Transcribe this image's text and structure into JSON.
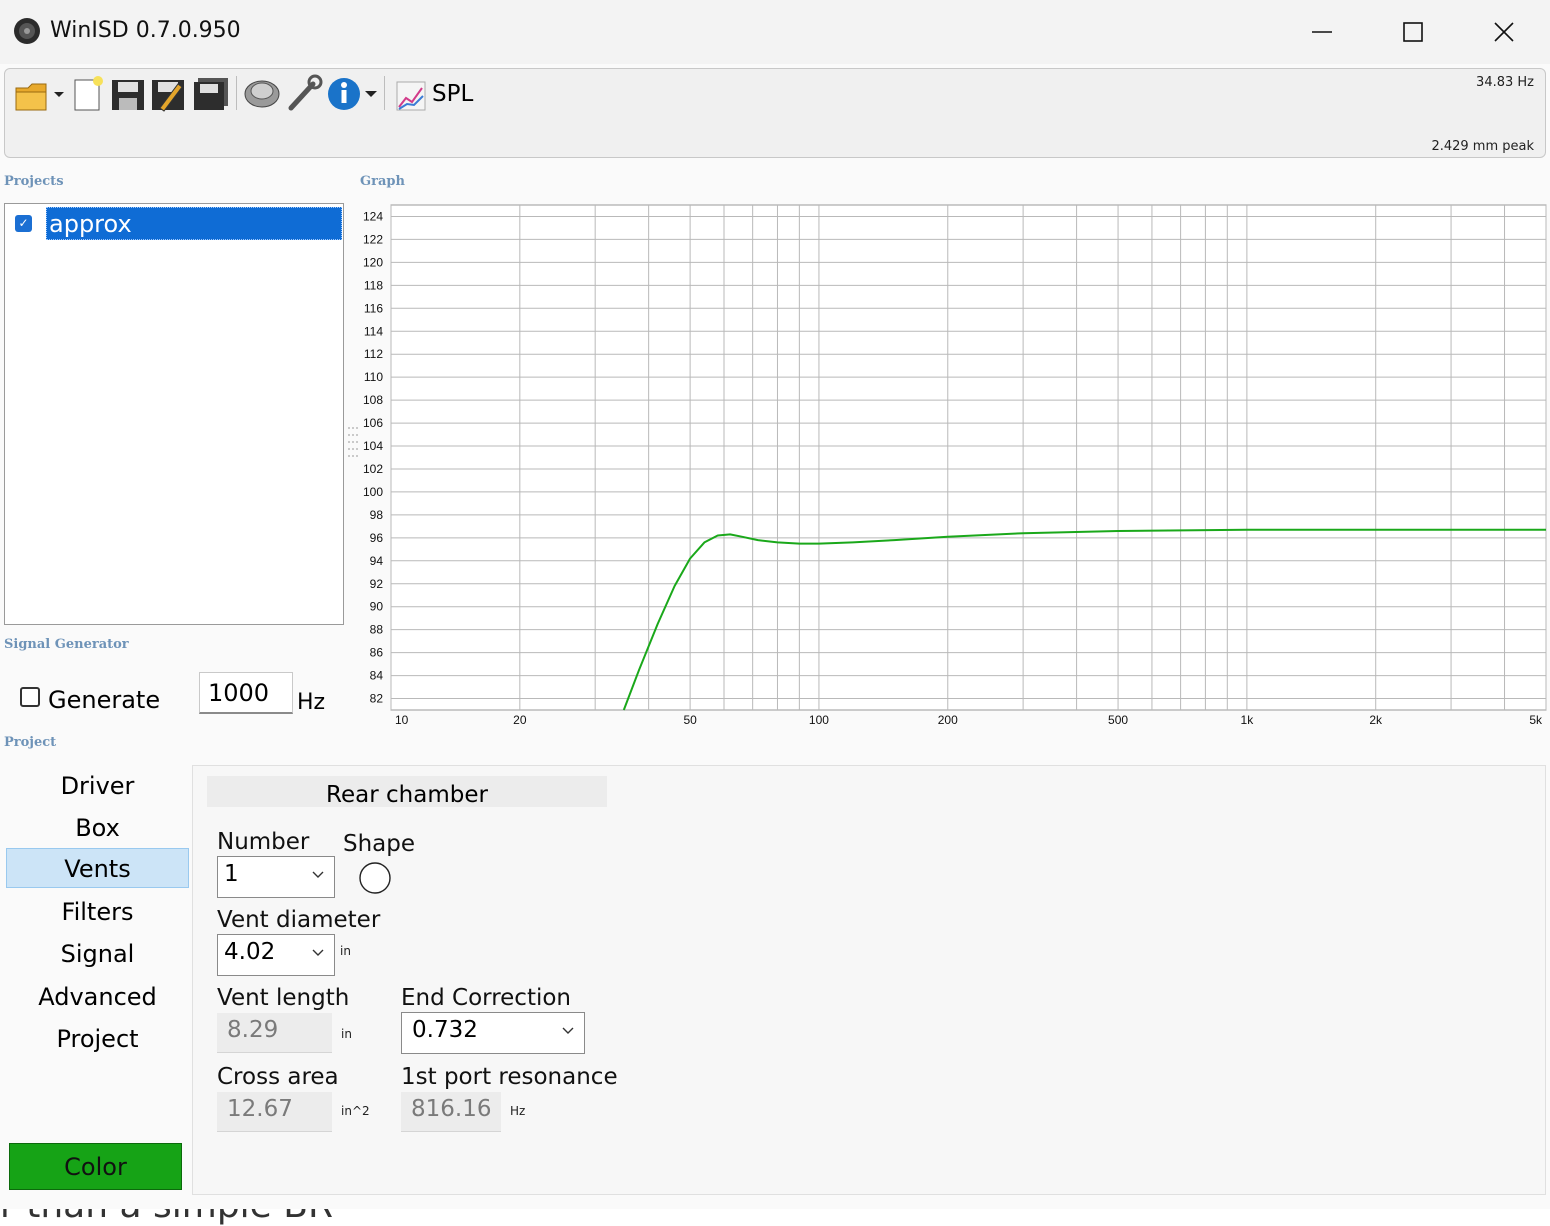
{
  "window": {
    "title": "WinISD 0.7.0.950"
  },
  "toolbar": {
    "open_icon": "folder-open-icon",
    "new_icon": "new-document-icon",
    "save_icon": "save-icon",
    "save_as_icon": "save-as-icon",
    "save_all_icon": "save-all-icon",
    "driver_icon": "speaker-driver-icon",
    "tools_icon": "wrench-icon",
    "info_icon": "info-icon",
    "spl_label": "SPL",
    "frequency_readout": "34.83 Hz",
    "excursion_readout": "2.429 mm peak"
  },
  "projects": {
    "label": "Projects",
    "items": [
      {
        "name": "approx",
        "checked": true
      }
    ]
  },
  "graph": {
    "label": "Graph"
  },
  "chart_data": {
    "type": "line",
    "xscale": "log",
    "xlim": [
      10,
      5000
    ],
    "ylim": [
      81,
      125
    ],
    "yticks": [
      82,
      84,
      86,
      88,
      90,
      92,
      94,
      96,
      98,
      100,
      102,
      104,
      106,
      108,
      110,
      112,
      114,
      116,
      118,
      120,
      122,
      124
    ],
    "xticks": [
      {
        "v": 10,
        "label": "10"
      },
      {
        "v": 20,
        "label": "20"
      },
      {
        "v": 50,
        "label": "50"
      },
      {
        "v": 100,
        "label": "100"
      },
      {
        "v": 200,
        "label": "200"
      },
      {
        "v": 500,
        "label": "500"
      },
      {
        "v": 1000,
        "label": "1k"
      },
      {
        "v": 2000,
        "label": "2k"
      },
      {
        "v": 5000,
        "label": "5k"
      }
    ],
    "grid": true,
    "series": [
      {
        "color": "#1aa81a",
        "x": [
          35,
          38,
          42,
          46,
          50,
          54,
          58,
          62,
          66,
          72,
          80,
          90,
          100,
          120,
          150,
          200,
          300,
          500,
          1000,
          2000,
          5000
        ],
        "y": [
          81,
          84.5,
          88.5,
          91.8,
          94.2,
          95.6,
          96.2,
          96.3,
          96.1,
          95.8,
          95.6,
          95.5,
          95.5,
          95.6,
          95.8,
          96.1,
          96.4,
          96.6,
          96.7,
          96.7,
          96.7
        ]
      }
    ]
  },
  "signal_generator": {
    "label": "Signal Generator",
    "generate_label": "Generate",
    "generate_checked": false,
    "frequency_value": "1000",
    "unit": "Hz"
  },
  "project_panel": {
    "label": "Project",
    "nav": [
      "Driver",
      "Box",
      "Vents",
      "Filters",
      "Signal",
      "Advanced",
      "Project"
    ],
    "active": "Vents",
    "color_button": "Color",
    "color_value": "#16a316"
  },
  "vents": {
    "chamber_tab": "Rear chamber",
    "number_label": "Number",
    "number_value": "1",
    "shape_label": "Shape",
    "shape_icon": "circle-shape-icon",
    "diameter_label": "Vent diameter",
    "diameter_value": "4.02",
    "diameter_unit": "in",
    "length_label": "Vent length",
    "length_value": "8.29",
    "length_unit": "in",
    "end_correction_label": "End Correction",
    "end_correction_value": "0.732",
    "cross_area_label": "Cross area",
    "cross_area_value": "12.67",
    "cross_area_unit": "in^2",
    "resonance_label": "1st port resonance",
    "resonance_value": "816.16",
    "resonance_unit": "Hz"
  },
  "background": {
    "partial_text": "r than a simple BR"
  }
}
